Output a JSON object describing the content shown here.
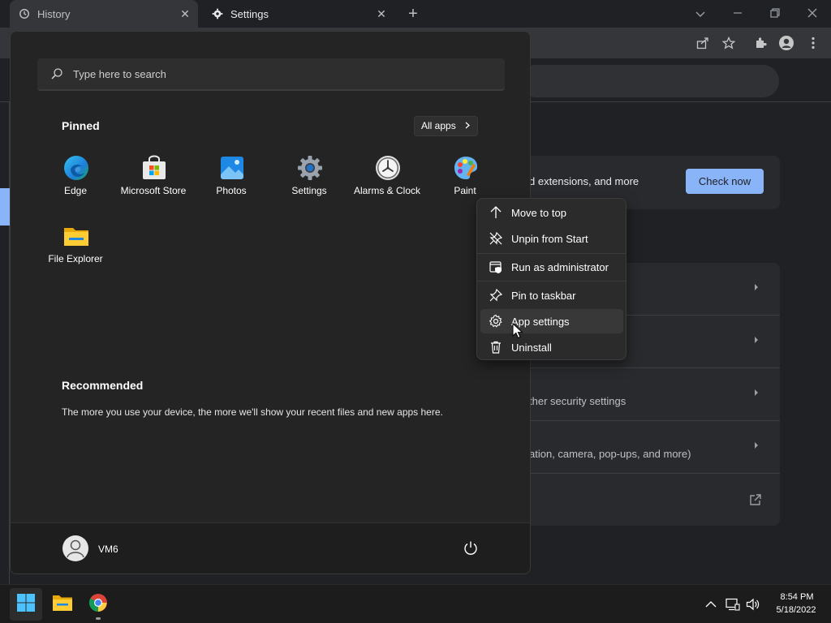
{
  "browser": {
    "tabs": [
      {
        "label": "History",
        "icon": "history-icon",
        "close": "✕"
      },
      {
        "label": "Settings",
        "icon": "gear-icon",
        "close": "✕"
      }
    ],
    "new_tab": "+",
    "window_controls": [
      "chevron-down-icon",
      "minimize-icon",
      "restore-icon",
      "close-icon"
    ],
    "toolbar_icons": [
      "share-icon",
      "star-icon",
      "extensions-icon",
      "profile-icon",
      "more-menu-icon"
    ]
  },
  "settings_page": {
    "safety_check_text": "d extensions, and more",
    "check_now_label": "Check now",
    "privacy_rows": [
      {
        "text": ""
      },
      {
        "text": ""
      },
      {
        "text": "ther security settings"
      },
      {
        "text": "ation, camera, pop-ups, and more)"
      },
      {
        "text": ""
      }
    ],
    "accent": "#8ab4f8"
  },
  "start_menu": {
    "search_placeholder": "Type here to search",
    "pinned_title": "Pinned",
    "all_apps_label": "All apps",
    "pinned_apps": [
      {
        "label": "Edge",
        "icon": "edge-icon"
      },
      {
        "label": "Microsoft Store",
        "icon": "store-icon"
      },
      {
        "label": "Photos",
        "icon": "photos-icon"
      },
      {
        "label": "Settings",
        "icon": "settings-icon"
      },
      {
        "label": "Alarms & Clock",
        "icon": "clock-icon"
      },
      {
        "label": "Paint",
        "icon": "paint-icon"
      },
      {
        "label": "File Explorer",
        "icon": "folder-icon"
      }
    ],
    "recommended_title": "Recommended",
    "recommended_text": "The more you use your device, the more we'll show your recent files and new apps here.",
    "user_name": "VM6"
  },
  "context_menu": {
    "items": [
      {
        "label": "Move to top",
        "icon": "arrow-up-icon"
      },
      {
        "label": "Unpin from Start",
        "icon": "unpin-icon"
      },
      {
        "label": "Run as administrator",
        "icon": "admin-shield-icon"
      },
      {
        "label": "Pin to taskbar",
        "icon": "pin-icon"
      },
      {
        "label": "App settings",
        "icon": "gear-icon"
      },
      {
        "label": "Uninstall",
        "icon": "trash-icon"
      }
    ],
    "hovered": "App settings"
  },
  "taskbar": {
    "items": [
      "start-button",
      "file-explorer",
      "chrome"
    ],
    "tray": [
      "chevron-up-icon",
      "network-icon",
      "volume-icon"
    ],
    "time": "8:54 PM",
    "date": "5/18/2022"
  }
}
